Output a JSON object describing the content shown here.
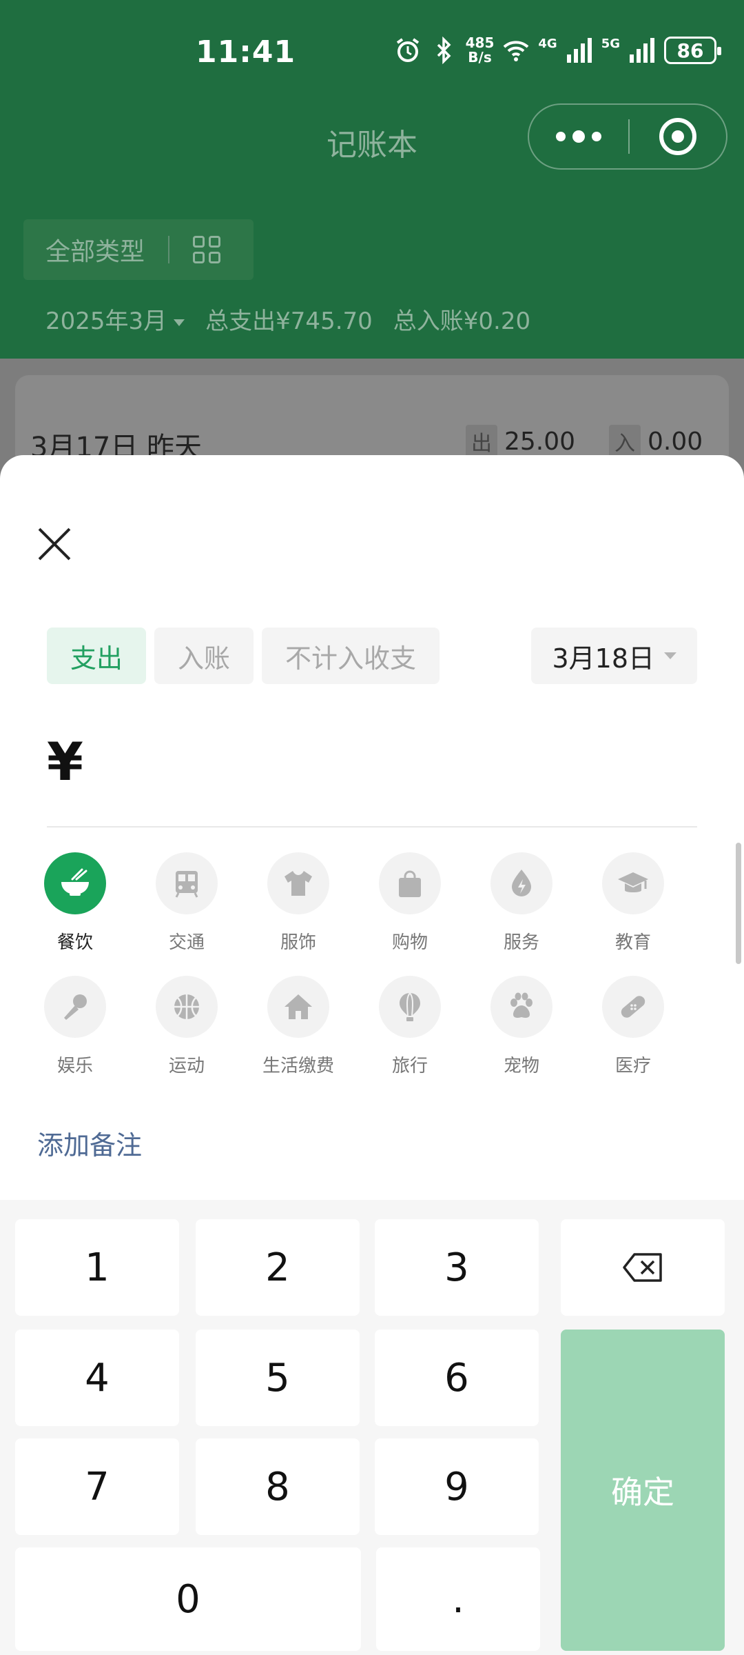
{
  "status_bar": {
    "time": "11:41",
    "net_speed_value": "485",
    "net_speed_unit": "B/s",
    "signal_1": "4G",
    "signal_2": "5G",
    "battery": "86"
  },
  "header": {
    "title": "记账本",
    "type_filter_label": "全部类型",
    "month": "2025年3月",
    "total_expense": "总支出¥745.70",
    "total_income": "总入账¥0.20"
  },
  "day_summary": {
    "date_label": "3月17日 昨天",
    "out_tag": "出",
    "out_value": "25.00",
    "in_tag": "入",
    "in_value": "0.00"
  },
  "sheet": {
    "tabs": [
      {
        "label": "支出",
        "active": true
      },
      {
        "label": "入账",
        "active": false
      },
      {
        "label": "不计入收支",
        "active": false
      }
    ],
    "date": "3月18日",
    "currency_symbol": "¥",
    "categories": [
      {
        "label": "餐饮",
        "icon": "bowl-icon",
        "active": true
      },
      {
        "label": "交通",
        "icon": "bus-icon"
      },
      {
        "label": "服饰",
        "icon": "shirt-icon"
      },
      {
        "label": "购物",
        "icon": "shopping-bag-icon"
      },
      {
        "label": "服务",
        "icon": "lightning-drop-icon"
      },
      {
        "label": "教育",
        "icon": "graduation-cap-icon"
      },
      {
        "label": "娱乐",
        "icon": "microphone-icon"
      },
      {
        "label": "运动",
        "icon": "basketball-icon"
      },
      {
        "label": "生活缴费",
        "icon": "house-icon"
      },
      {
        "label": "旅行",
        "icon": "hot-air-balloon-icon"
      },
      {
        "label": "宠物",
        "icon": "paw-icon"
      },
      {
        "label": "医疗",
        "icon": "bandage-icon"
      }
    ],
    "note_link": "添加备注"
  },
  "keypad": {
    "k1": "1",
    "k2": "2",
    "k3": "3",
    "k4": "4",
    "k5": "5",
    "k6": "6",
    "k7": "7",
    "k8": "8",
    "k9": "9",
    "k0": "0",
    "kdot": ".",
    "confirm": "确定"
  },
  "colors": {
    "header_green": "#1f6e40",
    "accent_green": "#1aa45a",
    "confirm_green": "#9cd6b4",
    "link_blue": "#4f6a94"
  }
}
